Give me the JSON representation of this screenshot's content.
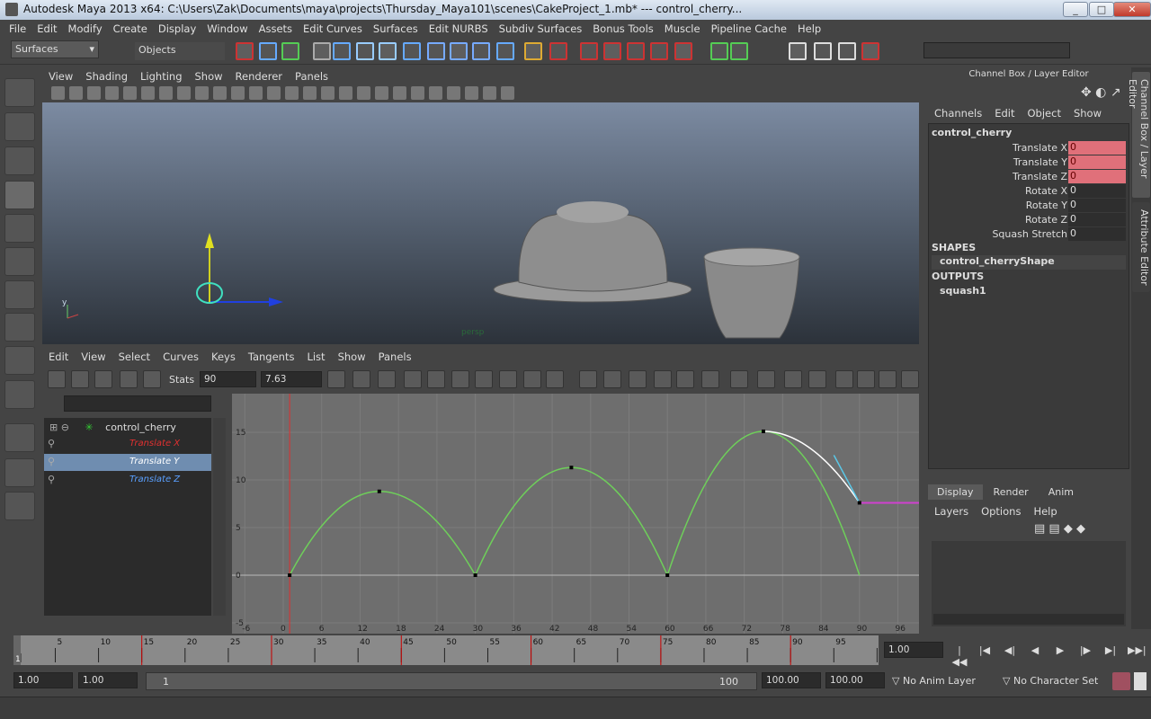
{
  "window": {
    "title": "Autodesk Maya 2013 x64: C:\\Users\\Zak\\Documents\\maya\\projects\\Thursday_Maya101\\scenes\\CakeProject_1.mb*  ---  control_cherry...",
    "buttons": [
      "_",
      "□",
      "✕"
    ]
  },
  "menubar": [
    "File",
    "Edit",
    "Modify",
    "Create",
    "Display",
    "Window",
    "Assets",
    "Edit Curves",
    "Surfaces",
    "Edit NURBS",
    "Subdiv Surfaces",
    "Bonus Tools",
    "Muscle",
    "Pipeline Cache",
    "Help"
  ],
  "shelf": {
    "menu_set": "Surfaces",
    "selection_mode": "Objects"
  },
  "viewport": {
    "menu": [
      "View",
      "Shading",
      "Lighting",
      "Show",
      "Renderer",
      "Panels"
    ],
    "camera_label": "persp",
    "axis_y": "y",
    "axis_x": "x"
  },
  "graph_editor": {
    "menu": [
      "Edit",
      "View",
      "Select",
      "Curves",
      "Keys",
      "Tangents",
      "List",
      "Show",
      "Panels"
    ],
    "stats_label": "Stats",
    "stats_frame": "90",
    "stats_value": "7.63",
    "outliner": {
      "object": "control_cherry",
      "channels": [
        {
          "label": "Translate X",
          "color": "#e03030"
        },
        {
          "label": "Translate Y",
          "color": "#ffffff",
          "selected": true
        },
        {
          "label": "Translate Z",
          "color": "#5aa0ff"
        }
      ]
    }
  },
  "chart_data": {
    "type": "line",
    "title": "",
    "xlabel": "",
    "ylabel": "",
    "xlim": [
      -6,
      99
    ],
    "ylim": [
      -5.5,
      17
    ],
    "xticks": [
      -6,
      0,
      6,
      12,
      18,
      24,
      30,
      36,
      42,
      48,
      54,
      60,
      66,
      72,
      78,
      84,
      90,
      96
    ],
    "yticks": [
      -5,
      0,
      5,
      10,
      15
    ],
    "grid": true,
    "current_time": 1,
    "series": [
      {
        "name": "Translate Y",
        "color": "#6ecf5a",
        "selected_color": "#ffffff",
        "keys": [
          [
            1,
            0
          ],
          [
            15,
            8.8
          ],
          [
            30,
            0
          ],
          [
            45,
            11.3
          ],
          [
            60,
            0
          ],
          [
            75,
            15.1
          ],
          [
            90,
            7.6
          ]
        ]
      }
    ]
  },
  "channel_box": {
    "title": "Channel Box / Layer Editor",
    "menu": [
      "Channels",
      "Edit",
      "Object",
      "Show"
    ],
    "object": "control_cherry",
    "attributes": [
      {
        "name": "Translate X",
        "value": "0",
        "keyed": true
      },
      {
        "name": "Translate Y",
        "value": "0",
        "keyed": true
      },
      {
        "name": "Translate Z",
        "value": "0",
        "keyed": true
      },
      {
        "name": "Rotate X",
        "value": "0",
        "keyed": false
      },
      {
        "name": "Rotate Y",
        "value": "0",
        "keyed": false
      },
      {
        "name": "Rotate Z",
        "value": "0",
        "keyed": false
      },
      {
        "name": "Squash Stretch",
        "value": "0",
        "keyed": false
      }
    ],
    "shapes_header": "SHAPES",
    "shape": "control_cherryShape",
    "outputs_header": "OUTPUTS",
    "output": "squash1"
  },
  "layer_editor": {
    "tabs": [
      "Display",
      "Render",
      "Anim"
    ],
    "active_tab": "Display",
    "menu": [
      "Layers",
      "Options",
      "Help"
    ]
  },
  "side_tabs": [
    "Channel Box / Layer Editor",
    "Attribute Editor"
  ],
  "timeline": {
    "ticks": [
      "5",
      "10",
      "15",
      "20",
      "25",
      "30",
      "35",
      "40",
      "45",
      "50",
      "55",
      "60",
      "65",
      "70",
      "75",
      "80",
      "85",
      "90",
      "95",
      "10"
    ],
    "current_frame": "1",
    "current_time_field": "1.00",
    "key_frames": [
      15,
      30,
      45,
      60,
      75,
      90
    ]
  },
  "range": {
    "start": "1.00",
    "playback_start": "1.00",
    "slider_start": "1",
    "slider_end": "100",
    "playback_end": "100.00",
    "end": "100.00",
    "anim_layer": "No Anim Layer",
    "character_set": "No Character Set"
  },
  "colors": {
    "keyed": "#e0707a",
    "curve": "#6ecf5a",
    "current_time": "#e03030",
    "infinity": "#d040d0",
    "tangent": "#5ac8e8"
  }
}
